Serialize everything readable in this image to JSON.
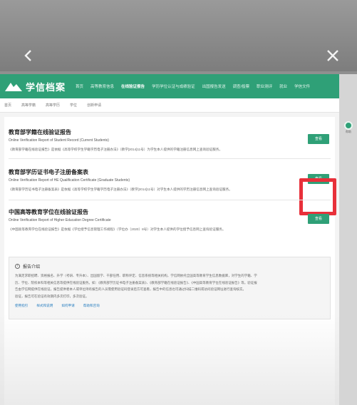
{
  "header": {
    "logo_text": "学信档案",
    "menu": [
      "首页",
      "高等教育信息",
      "在线验证报告",
      "学历学位认证与成绩验证",
      "出国报告发送",
      "调查/投票",
      "职业测评",
      "就业",
      "学信文件"
    ]
  },
  "side_widget": {
    "label": "帮助"
  },
  "subnav": [
    "首页",
    "高等学籍",
    "高等学历",
    "学位",
    "创新申请"
  ],
  "reports": [
    {
      "title": "教育部学籍在线验证报告",
      "subtitle": "Online Verification Report of Student Record (Current Students)",
      "desc": "《教育部学籍在线验证报告》是依据《高等学校学生学籍学历电子注册办法》（教学[2014]11号）为学生本人提供的学籍注册信息网上查询验证服务。",
      "button": "查看"
    },
    {
      "title": "教育部学历证书电子注册备案表",
      "subtitle": "Online Verification Report of HE Qualification Certificate (Graduate Students)",
      "desc": "《教育部学历证书电子注册备案表》是依据《高等学校学生学籍学历电子注册办法》（教学[2014]11号）对学生本人提供的学历注册信息网上查询验证服务。",
      "button": "查看"
    },
    {
      "title": "中国高等教育学位在线验证报告",
      "subtitle": "Online Verification Report of Higher Education Degree Certificate",
      "desc": "《中国高等教育学位在线验证报告》是依据《学位授予信息管理工作规程》（学位办〔2020〕8号）对学生本人提供的学位授予信息网上查询验证服务。",
      "button": "查看"
    }
  ],
  "intro": {
    "title": "报告介绍",
    "lines": [
      "为满足求职招聘、资格报名、升学（考研、专升本）、出国留学、干部任用、职称评定、信息系统等相关机构，学信网依托全国高等教育学生信息数据库，对学生的学籍、学",
      "历、学位、院校本科等相关信息等提供在线验证服务。如：《教育部学历证书电子注册备案表》、《教育部学籍在线验证报告》、《中国高等教育学位在线验证报告》等。验证报",
      "告由学信网提供在线验证，报告提供者本人或单位持有报告的人员需使用验证码登录后方可查看，报告中的信息也可通过扫描二维码或访问验证网址进行查询核实。",
      "验证，报告可在验证有效期内多次打印，多次验证。"
    ],
    "links": [
      "使用指引",
      "样式和说明",
      "如何申请",
      "帮助和咨询"
    ]
  }
}
